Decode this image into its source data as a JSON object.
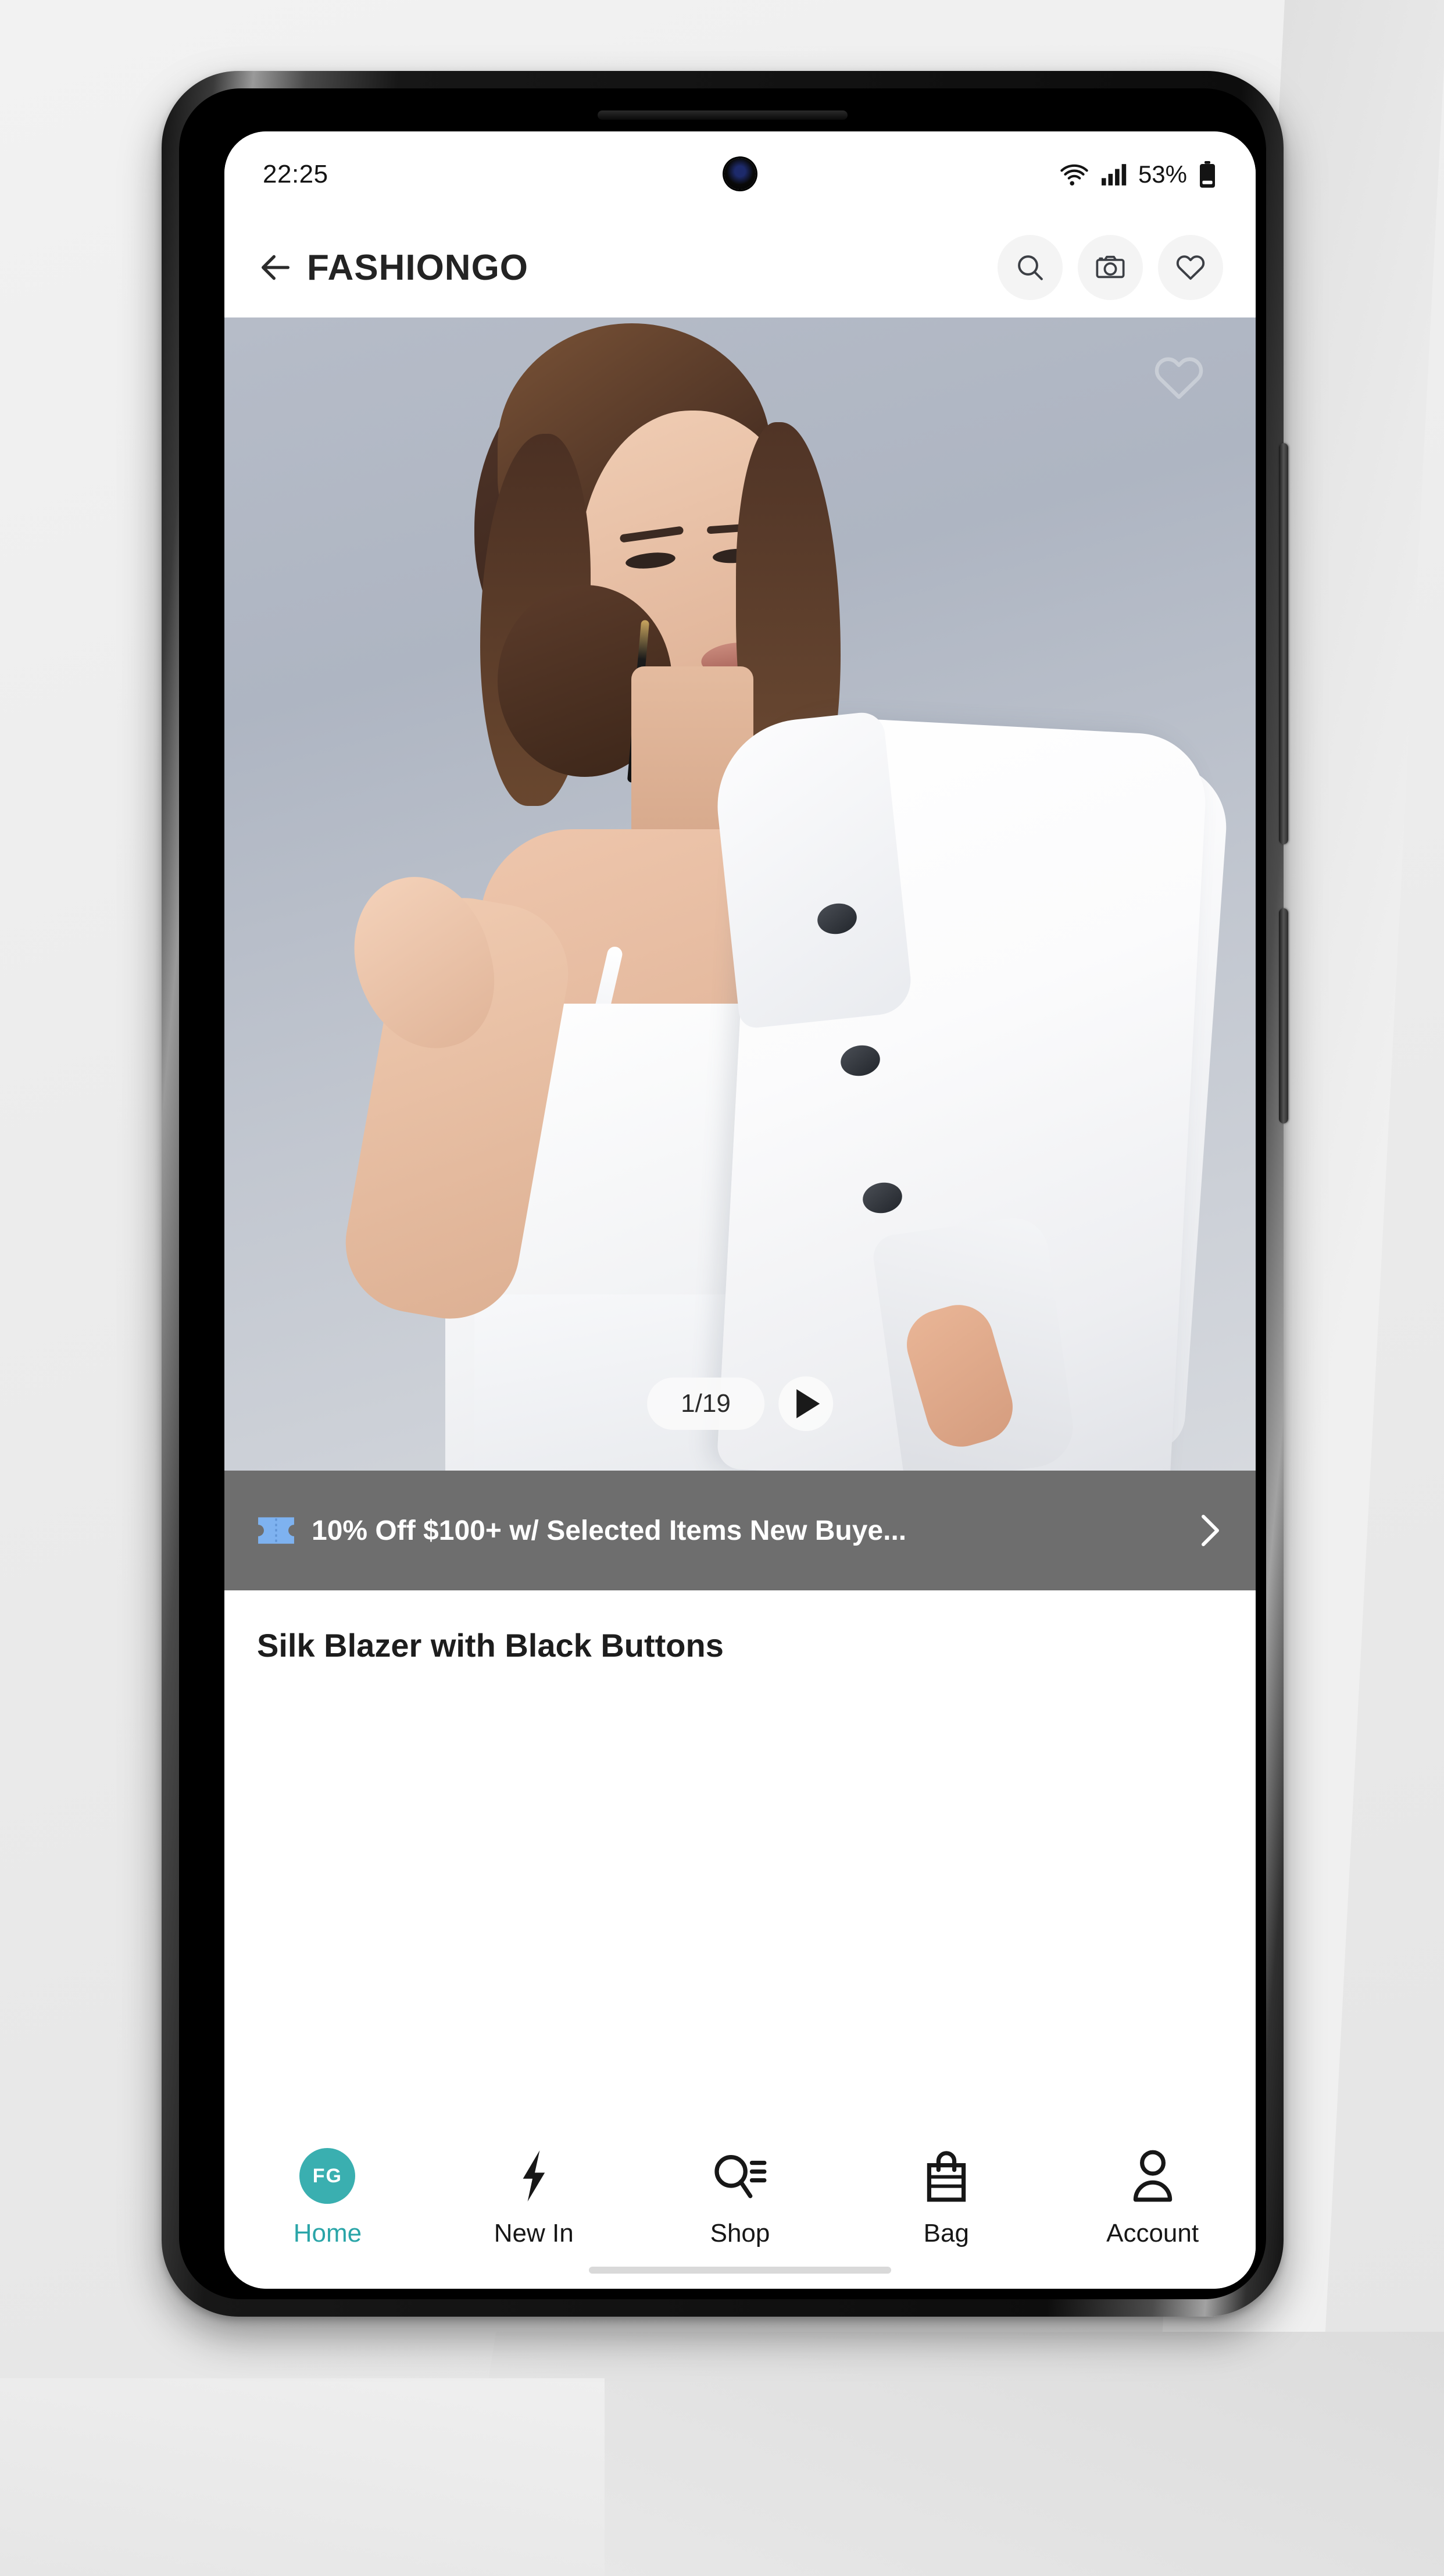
{
  "status_bar": {
    "time": "22:25",
    "battery_percent": "53%",
    "wifi_icon": "wifi-icon",
    "signal_icon": "cellular-signal-icon",
    "battery_icon": "battery-icon"
  },
  "app_header": {
    "back_icon": "back-arrow-icon",
    "brand": "FASHIONGO",
    "actions": [
      {
        "icon": "search-icon",
        "label": "Search"
      },
      {
        "icon": "camera-icon",
        "label": "Visual search"
      },
      {
        "icon": "heart-icon",
        "label": "Wishlist"
      }
    ]
  },
  "hero": {
    "favorite_icon": "heart-outline-icon",
    "page_indicator": "1/19",
    "current_index": 1,
    "total_images": 19,
    "play_icon": "play-icon",
    "alt": "Model wearing white silk dress with white blazer draped over shoulder"
  },
  "promo_banner": {
    "ticket_icon": "coupon-ticket-icon",
    "text": "10% Off $100+ w/ Selected Items New Buye...",
    "chevron_icon": "chevron-right-icon",
    "background_color": "#6e6e6e",
    "ticket_color": "#7eb2f0"
  },
  "product": {
    "title": "Silk Blazer with Black Buttons"
  },
  "bottom_nav": {
    "active_index": 0,
    "accent_color": "#2aa5a8",
    "items": [
      {
        "label": "Home",
        "icon": "fashiongo-logo-icon",
        "badge_text": "FG"
      },
      {
        "label": "New In",
        "icon": "lightning-bolt-icon"
      },
      {
        "label": "Shop",
        "icon": "shop-search-icon"
      },
      {
        "label": "Bag",
        "icon": "shopping-bag-icon"
      },
      {
        "label": "Account",
        "icon": "person-icon"
      }
    ]
  }
}
